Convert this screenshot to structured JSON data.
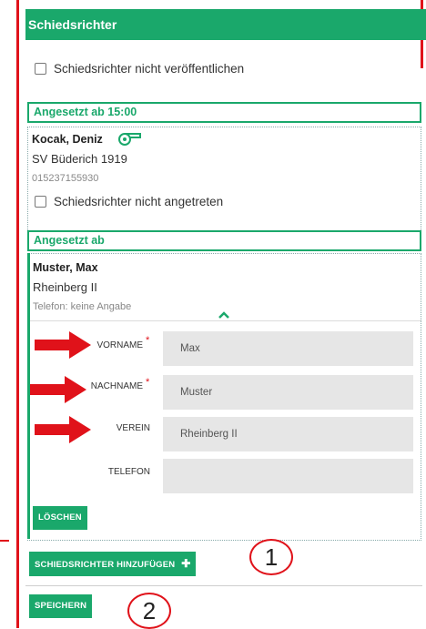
{
  "header": {
    "title": "Schiedsrichter"
  },
  "hide_referees": {
    "label": "Schiedsrichter nicht veröffentlichen",
    "checked": false
  },
  "slot1": {
    "heading": "Angesetzt ab 15:00",
    "referee": {
      "name": "Kocak, Deniz",
      "club": "SV Büderich 1919",
      "phone": "015237155930",
      "icon": "whistle-icon"
    },
    "not_appeared": {
      "label": "Schiedsrichter nicht angetreten",
      "checked": false
    }
  },
  "slot2": {
    "heading": "Angesetzt ab",
    "referee": {
      "name": "Muster, Max",
      "club": "Rheinberg II",
      "phone": "Telefon: keine Angabe"
    },
    "toggle_icon": "chevron-up-icon",
    "form": {
      "first_name": {
        "label": "VORNAME",
        "required": "*",
        "value": "Max"
      },
      "last_name": {
        "label": "NACHNAME",
        "required": "*",
        "value": "Muster"
      },
      "club": {
        "label": "VEREIN",
        "value": "Rheinberg II"
      },
      "phone": {
        "label": "TELEFON",
        "value": ""
      }
    },
    "delete_label": "LÖSCHEN"
  },
  "add_referee": {
    "label": "SCHIEDSRICHTER HINZUFÜGEN",
    "icon": "plus-icon"
  },
  "save_label": "SPEICHERN",
  "annotations": {
    "marker1": "1",
    "marker2": "2"
  },
  "colors": {
    "accent": "#1aa86b",
    "annotation": "#e0121a"
  }
}
